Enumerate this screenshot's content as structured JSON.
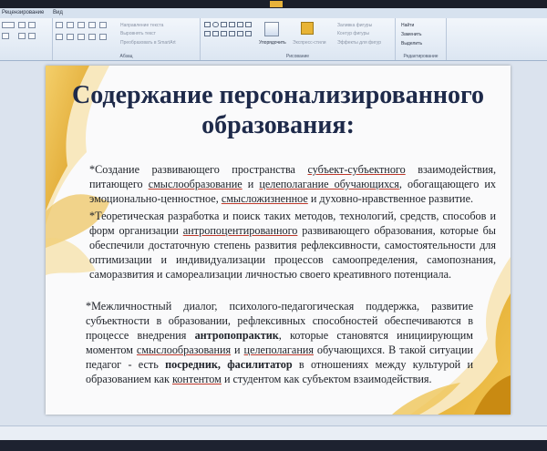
{
  "ribbon": {
    "tabs": [
      "Рецензирование",
      "Вид"
    ],
    "groups": {
      "paragraph": "Абзац",
      "drawing": "Рисование",
      "editing": "Редактирование"
    },
    "buttons": {
      "text_direction": "Направление текста",
      "align_text": "Выровнять текст",
      "convert_smartart": "Преобразовать в SmartArt",
      "arrange": "Упорядочить",
      "quick_styles": "Экспресс-стили",
      "shape_fill": "Заливка фигуры",
      "shape_outline": "Контур фигуры",
      "shape_effects": "Эффекты для фигур",
      "find": "Найти",
      "replace": "Заменить",
      "select": "Выделить"
    }
  },
  "slide": {
    "title": "Содержание персонализированного образования:",
    "p1": {
      "t1": "*Создание развивающего пространства ",
      "u1": "субъект-субъектного",
      "t2": " взаимодействия, питающего ",
      "u2": "смыслообразование",
      "t3": " и ",
      "u3": "целеполагание обучающихся",
      "t4": ", обогащающего их эмоционально-ценностное, ",
      "u4": "смысложизненное",
      "t5": " и духовно-нравственное развитие."
    },
    "p2": {
      "t1": "*Теоретическая разработка и поиск таких методов, технологий, средств, способов и форм организации ",
      "u1": "антропоцентированного",
      "t2": " развивающего образования, которые бы обеспечили достаточную степень развития рефлексивности, самостоятельности для оптимизации и индивидуализации процессов самоопределения, самопознания, саморазвития и самореализации личностью своего креативного потенциала."
    },
    "p3": {
      "t1": "*Межличностный диалог, психолого-педагогическая поддержка, развитие субъектности в образовании, рефлексивных способностей обеспечиваются в процессе внедрения ",
      "b1": "антропопрактик",
      "t2": ", которые становятся инициирующим моментом ",
      "u1": "смыслообразования",
      "t3": " и ",
      "u2": "целеполагания",
      "t4": " обучающихся. В такой ситуации педагог - есть ",
      "b2": "посредник, фасилитатор",
      "t5": " в отношениях между культурой и образованием как ",
      "u3": "контентом",
      "t6": " и студентом как субъектом взаимодействия."
    }
  },
  "colors": {
    "accent_gold": "#e8b436",
    "title_navy": "#1e2a4a"
  }
}
